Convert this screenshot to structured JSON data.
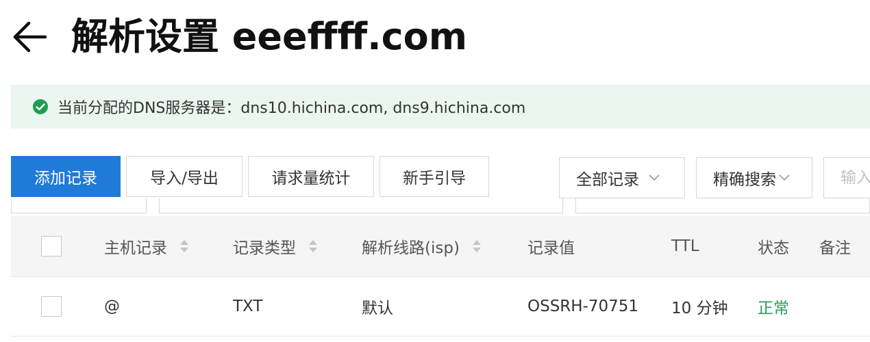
{
  "header": {
    "back_icon": "arrow-left-icon",
    "title": "解析设置 eeeffff.com"
  },
  "notice": {
    "icon": "check-circle-icon",
    "icon_color": "#1e9e4f",
    "text": "当前分配的DNS服务器是：dns10.hichina.com, dns9.hichina.com"
  },
  "toolbar": {
    "add_label": "添加记录",
    "import_label": "导入/导出",
    "stats_label": "请求量统计",
    "guide_label": "新手引导",
    "records_filter": "全部记录",
    "search_mode": "精确搜索",
    "search_placeholder": "输入"
  },
  "table": {
    "columns": {
      "host": "主机记录",
      "type": "记录类型",
      "line": "解析线路(isp)",
      "value": "记录值",
      "ttl": "TTL",
      "status": "状态",
      "remark": "备注"
    },
    "rows": [
      {
        "host": "@",
        "type": "TXT",
        "line": "默认",
        "value": "OSSRH-70751",
        "ttl": "10 分钟",
        "status": "正常",
        "remark": ""
      }
    ]
  },
  "colors": {
    "primary": "#1f7bd7",
    "status_ok": "#2a9d55",
    "notice_bg": "#eaf6ef"
  }
}
